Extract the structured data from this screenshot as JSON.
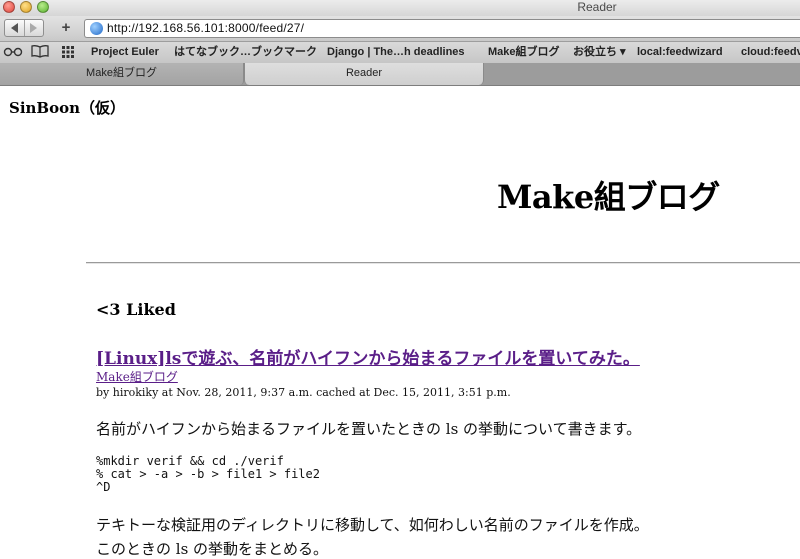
{
  "window": {
    "title": "Reader"
  },
  "toolbar": {
    "url": "http://192.168.56.101:8000/feed/27/",
    "new_tab_label": "+"
  },
  "bookmarks": {
    "icons": [
      "reading-list-glasses",
      "open-book",
      "grid"
    ],
    "items": [
      {
        "label": "Project Euler"
      },
      {
        "label": "はてなブック…ブックマーク"
      },
      {
        "label": "Django | The…h deadlines"
      },
      {
        "label": "Make組ブログ"
      },
      {
        "label": "お役立ち ▾"
      },
      {
        "label": "local:feedwizard"
      },
      {
        "label": "cloud:feedv"
      }
    ]
  },
  "tabs": [
    {
      "label": "Make組ブログ",
      "active": false
    },
    {
      "label": "Reader",
      "active": true
    }
  ],
  "page": {
    "site_name": "SinBoon（仮）",
    "feed_title": "Make組ブログ",
    "section_heading": "<3 Liked",
    "entry": {
      "title": "[Linux]lsで遊ぶ、名前がハイフンから始まるファイルを置いてみた。",
      "feed_name": "Make組ブログ",
      "meta": "by hirokiky at Nov. 28, 2011, 9:37 a.m. cached at Dec. 15, 2011, 3:51 p.m.",
      "paragraph1": "名前がハイフンから始まるファイルを置いたときの ls の挙動について書きます。",
      "code": "%mkdir verif && cd ./verif\n% cat > -a > -b > file1 > file2\n^D",
      "paragraph2": "テキトーな検証用のディレクトリに移動して、如何わしい名前のファイルを作成。",
      "paragraph3": "このときの ls の挙動をまとめる。"
    }
  },
  "colors": {
    "link_visited": "#5a1e88",
    "page_background": "#ffffff"
  }
}
